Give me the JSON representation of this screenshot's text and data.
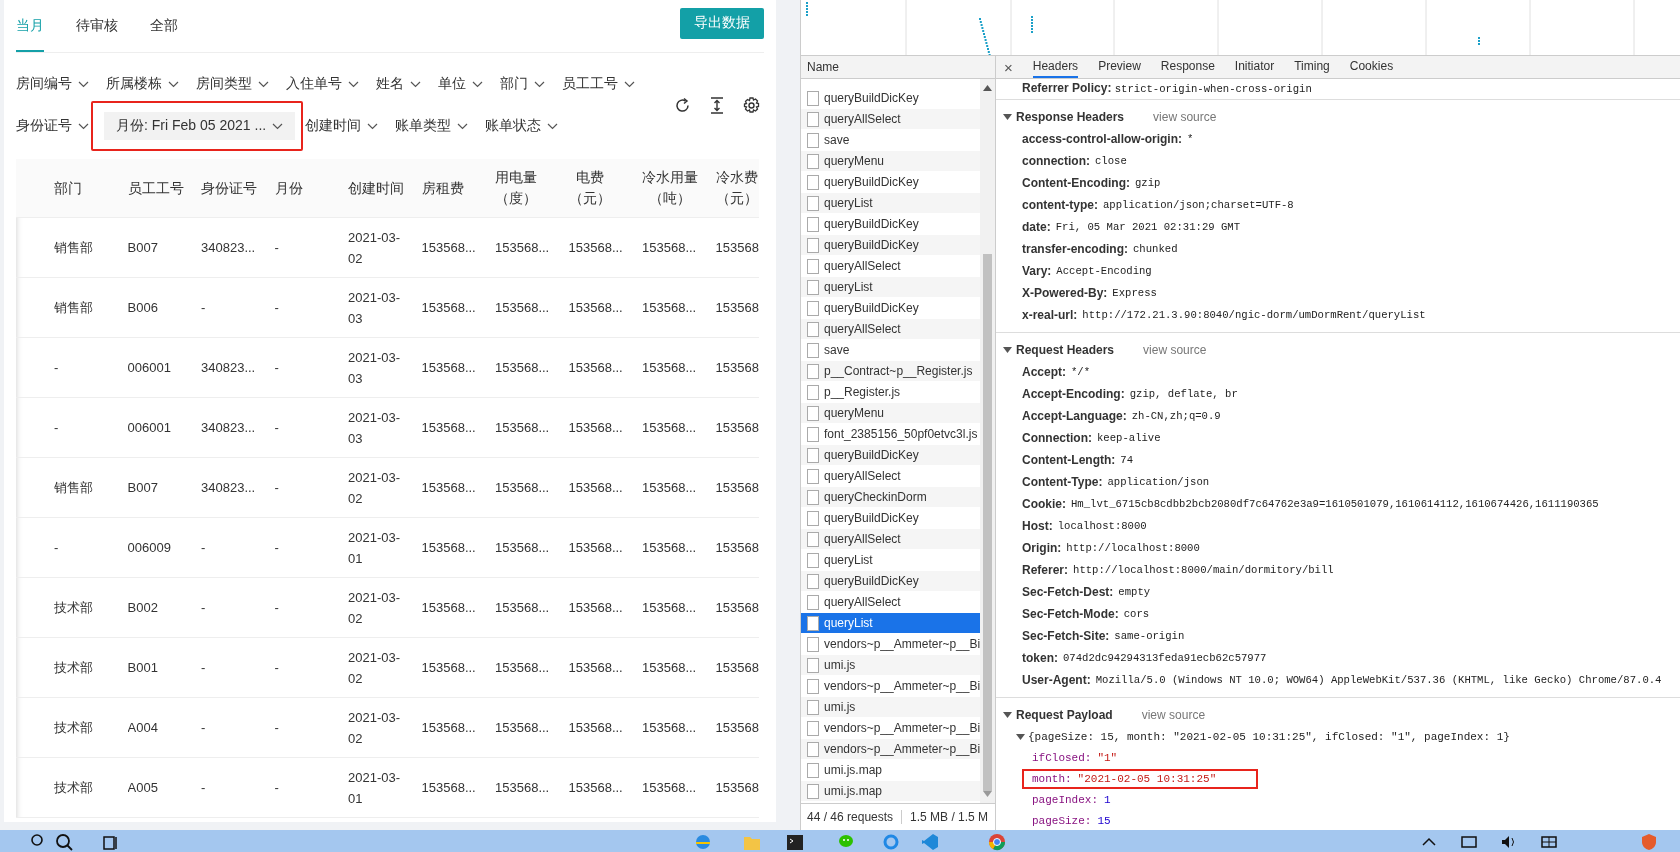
{
  "app": {
    "tabs": [
      {
        "label": "当月",
        "selected": true
      },
      {
        "label": "待审核",
        "selected": false
      },
      {
        "label": "全部",
        "selected": false
      }
    ],
    "export_button": "导出数据",
    "filter_rows": [
      [
        {
          "label": "房间编号",
          "active": false,
          "highlighted": false
        },
        {
          "label": "所属楼栋",
          "active": false,
          "highlighted": false
        },
        {
          "label": "房间类型",
          "active": false,
          "highlighted": false
        },
        {
          "label": "入住单号",
          "active": false,
          "highlighted": false
        },
        {
          "label": "姓名",
          "active": false,
          "highlighted": false
        },
        {
          "label": "单位",
          "active": false,
          "highlighted": false
        },
        {
          "label": "部门",
          "active": false,
          "highlighted": false
        },
        {
          "label": "员工工号",
          "active": false,
          "highlighted": false
        }
      ],
      [
        {
          "label": "身份证号",
          "active": false,
          "highlighted": false
        },
        {
          "label": "月份: Fri Feb 05 2021 ...",
          "active": true,
          "highlighted": true
        },
        {
          "label": "创建时间",
          "active": false,
          "highlighted": false
        },
        {
          "label": "账单类型",
          "active": false,
          "highlighted": false
        },
        {
          "label": "账单状态",
          "active": false,
          "highlighted": false
        }
      ]
    ],
    "table": {
      "columns": [
        {
          "label": "部门"
        },
        {
          "label": "员工工号"
        },
        {
          "label": "身份证号"
        },
        {
          "label": "月份"
        },
        {
          "label": "创建时间",
          "kind": "date"
        },
        {
          "label": "房租费"
        },
        {
          "label": "用电量",
          "unit": "（度）"
        },
        {
          "label": "电费",
          "unit": "（元）"
        },
        {
          "label": "冷水用量",
          "unit": "（吨）"
        },
        {
          "label": "冷水费",
          "unit": "（元）"
        }
      ],
      "rows": [
        [
          "销售部",
          "B007",
          "340823...",
          "-",
          "2021-03-02",
          "153568...",
          "153568...",
          "153568...",
          "153568...",
          "153568"
        ],
        [
          "销售部",
          "B006",
          "-",
          "-",
          "2021-03-03",
          "153568...",
          "153568...",
          "153568...",
          "153568...",
          "153568"
        ],
        [
          "-",
          "006001",
          "340823...",
          "-",
          "2021-03-03",
          "153568...",
          "153568...",
          "153568...",
          "153568...",
          "153568"
        ],
        [
          "-",
          "006001",
          "340823...",
          "-",
          "2021-03-03",
          "153568...",
          "153568...",
          "153568...",
          "153568...",
          "153568"
        ],
        [
          "销售部",
          "B007",
          "340823...",
          "-",
          "2021-03-02",
          "153568...",
          "153568...",
          "153568...",
          "153568...",
          "153568"
        ],
        [
          "-",
          "006009",
          "-",
          "-",
          "2021-03-01",
          "153568...",
          "153568...",
          "153568...",
          "153568...",
          "153568"
        ],
        [
          "技术部",
          "B002",
          "-",
          "-",
          "2021-03-02",
          "153568...",
          "153568...",
          "153568...",
          "153568...",
          "153568"
        ],
        [
          "技术部",
          "B001",
          "-",
          "-",
          "2021-03-02",
          "153568...",
          "153568...",
          "153568...",
          "153568...",
          "153568"
        ],
        [
          "技术部",
          "A004",
          "-",
          "-",
          "2021-03-02",
          "153568...",
          "153568...",
          "153568...",
          "153568...",
          "153568"
        ],
        [
          "技术部",
          "A005",
          "-",
          "-",
          "2021-03-01",
          "153568...",
          "153568...",
          "153568...",
          "153568...",
          "153568"
        ]
      ]
    }
  },
  "devtools": {
    "name_header": "Name",
    "requests": [
      {
        "name": "queryBuildDicKey",
        "selected": false
      },
      {
        "name": "queryAllSelect",
        "selected": false
      },
      {
        "name": "save",
        "selected": false
      },
      {
        "name": "queryMenu",
        "selected": false
      },
      {
        "name": "queryBuildDicKey",
        "selected": false
      },
      {
        "name": "queryList",
        "selected": false
      },
      {
        "name": "queryBuildDicKey",
        "selected": false
      },
      {
        "name": "queryBuildDicKey",
        "selected": false
      },
      {
        "name": "queryAllSelect",
        "selected": false
      },
      {
        "name": "queryList",
        "selected": false
      },
      {
        "name": "queryBuildDicKey",
        "selected": false
      },
      {
        "name": "queryAllSelect",
        "selected": false
      },
      {
        "name": "save",
        "selected": false
      },
      {
        "name": "p__Contract~p__Register.js",
        "selected": false
      },
      {
        "name": "p__Register.js",
        "selected": false
      },
      {
        "name": "queryMenu",
        "selected": false
      },
      {
        "name": "font_2385156_50pf0etvc3l.js",
        "selected": false
      },
      {
        "name": "queryBuildDicKey",
        "selected": false
      },
      {
        "name": "queryAllSelect",
        "selected": false
      },
      {
        "name": "queryCheckinDorm",
        "selected": false
      },
      {
        "name": "queryBuildDicKey",
        "selected": false
      },
      {
        "name": "queryAllSelect",
        "selected": false
      },
      {
        "name": "queryList",
        "selected": false
      },
      {
        "name": "queryBuildDicKey",
        "selected": false
      },
      {
        "name": "queryAllSelect",
        "selected": false
      },
      {
        "name": "queryList",
        "selected": true
      },
      {
        "name": "vendors~p__Ammeter~p__Bi",
        "selected": false
      },
      {
        "name": "umi.js",
        "selected": false
      },
      {
        "name": "vendors~p__Ammeter~p__Bi",
        "selected": false
      },
      {
        "name": "umi.js",
        "selected": false
      },
      {
        "name": "vendors~p__Ammeter~p__Bi",
        "selected": false
      },
      {
        "name": "vendors~p__Ammeter~p__Bi",
        "selected": false
      },
      {
        "name": "umi.js.map",
        "selected": false
      },
      {
        "name": "umi.js.map",
        "selected": false
      }
    ],
    "status": {
      "count": "44 / 46 requests",
      "size": "1.5 MB / 1.5 M"
    },
    "close": "×",
    "tabs": [
      {
        "label": "Headers",
        "selected": true
      },
      {
        "label": "Preview",
        "selected": false
      },
      {
        "label": "Response",
        "selected": false
      },
      {
        "label": "Initiator",
        "selected": false
      },
      {
        "label": "Timing",
        "selected": false
      },
      {
        "label": "Cookies",
        "selected": false
      }
    ],
    "referrer": {
      "key": "Referrer Policy:",
      "value": "strict-origin-when-cross-origin"
    },
    "sections": [
      {
        "title": "Response Headers",
        "link": "view source",
        "expanded": true,
        "headers": [
          {
            "key": "access-control-allow-origin:",
            "value": "*"
          },
          {
            "key": "connection:",
            "value": "close"
          },
          {
            "key": "Content-Encoding:",
            "value": "gzip"
          },
          {
            "key": "content-type:",
            "value": "application/json;charset=UTF-8"
          },
          {
            "key": "date:",
            "value": "Fri, 05 Mar 2021 02:31:29 GMT"
          },
          {
            "key": "transfer-encoding:",
            "value": "chunked"
          },
          {
            "key": "Vary:",
            "value": "Accept-Encoding"
          },
          {
            "key": "X-Powered-By:",
            "value": "Express"
          },
          {
            "key": "x-real-url:",
            "value": "http://172.21.3.90:8040/ngic-dorm/umDormRent/queryList"
          }
        ]
      },
      {
        "title": "Request Headers",
        "link": "view source",
        "expanded": true,
        "headers": [
          {
            "key": "Accept:",
            "value": "*/*"
          },
          {
            "key": "Accept-Encoding:",
            "value": "gzip, deflate, br"
          },
          {
            "key": "Accept-Language:",
            "value": "zh-CN,zh;q=0.9"
          },
          {
            "key": "Connection:",
            "value": "keep-alive"
          },
          {
            "key": "Content-Length:",
            "value": "74"
          },
          {
            "key": "Content-Type:",
            "value": "application/json"
          },
          {
            "key": "Cookie:",
            "value": "Hm_lvt_6715cb8cdbb2bcb2080df7c64762e3a9=1610501079,1610614112,1610674426,1611190365"
          },
          {
            "key": "Host:",
            "value": "localhost:8000"
          },
          {
            "key": "Origin:",
            "value": "http://localhost:8000"
          },
          {
            "key": "Referer:",
            "value": "http://localhost:8000/main/dormitory/bill"
          },
          {
            "key": "Sec-Fetch-Dest:",
            "value": "empty"
          },
          {
            "key": "Sec-Fetch-Mode:",
            "value": "cors"
          },
          {
            "key": "Sec-Fetch-Site:",
            "value": "same-origin"
          },
          {
            "key": "token:",
            "value": "074d2dc94294313feda91ecb62c57977"
          },
          {
            "key": "User-Agent:",
            "value": "Mozilla/5.0 (Windows NT 10.0; WOW64) AppleWebKit/537.36 (KHTML, like Gecko) Chrome/87.0.4"
          }
        ]
      }
    ],
    "payload": {
      "title": "Request Payload",
      "link": "view source",
      "expanded": true,
      "summary": "{pageSize: 15, month: \"2021-02-05 10:31:25\", ifClosed: \"1\", pageIndex: 1}",
      "fields": [
        {
          "key": "ifClosed:",
          "value": "\"1\"",
          "kind": "string",
          "highlighted": false
        },
        {
          "key": "month:",
          "value": "\"2021-02-05 10:31:25\"",
          "kind": "string",
          "highlighted": true
        },
        {
          "key": "pageIndex:",
          "value": "1",
          "kind": "number",
          "highlighted": false
        },
        {
          "key": "pageSize:",
          "value": "15",
          "kind": "number",
          "highlighted": false
        }
      ]
    }
  }
}
